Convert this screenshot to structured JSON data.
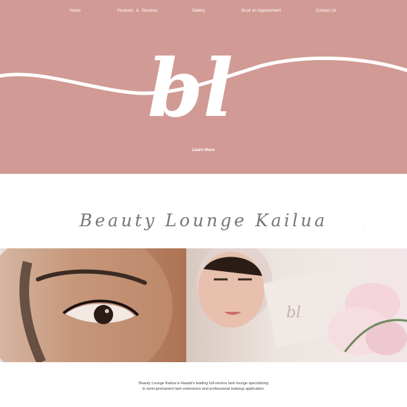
{
  "nav": {
    "items": [
      "Home",
      "Products & Services",
      "Gallery",
      "Book an Appointment",
      "Contact Us"
    ]
  },
  "hero": {
    "logo_text": "bl",
    "cta_label": "Learn More",
    "background_color": "#d19a95"
  },
  "brand": {
    "title": "Beauty Lounge Kailua"
  },
  "images": {
    "left_alt_icon": "eye-closeup-image",
    "right_alt_icon": "mirror-makeup-image"
  },
  "description": {
    "text": "Beauty Lounge Kailua is Hawaii's leading full-service lash lounge specializing in semi-permanent lash extensions and professional makeup application."
  }
}
